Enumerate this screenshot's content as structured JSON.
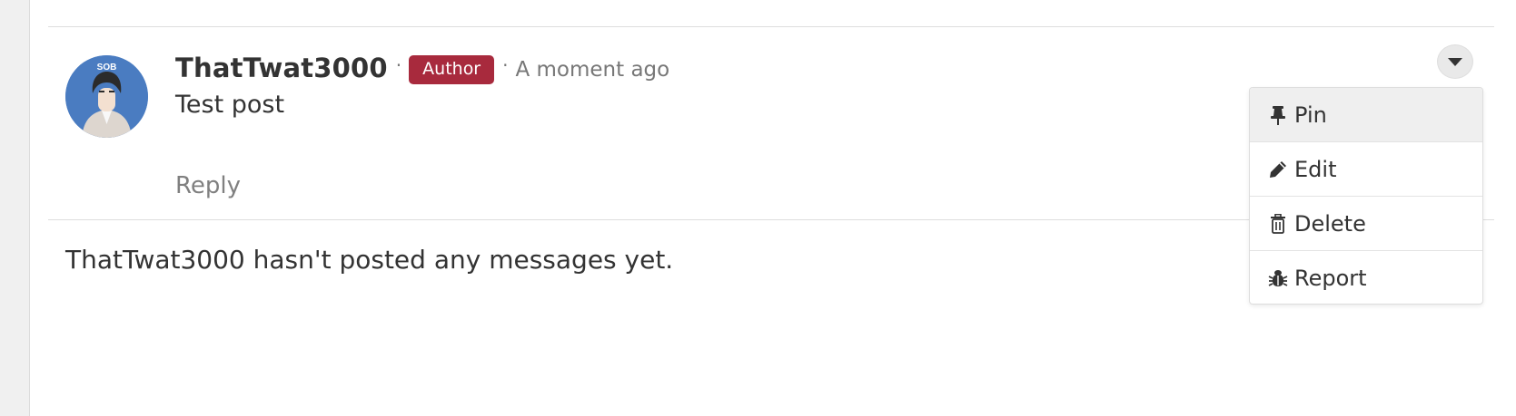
{
  "post": {
    "username": "ThatTwat3000",
    "separator": "·",
    "badge": "Author",
    "timestamp": "A moment ago",
    "body": "Test post",
    "reply_label": "Reply",
    "avatar_text": "SOB"
  },
  "empty_state": {
    "message": "ThatTwat3000 hasn't posted any messages yet."
  },
  "menu": {
    "toggle_icon": "caret-down-icon",
    "items": [
      {
        "label": "Pin",
        "icon": "pin-icon",
        "active": true
      },
      {
        "label": "Edit",
        "icon": "pencil-icon",
        "active": false
      },
      {
        "label": "Delete",
        "icon": "trash-icon",
        "active": false
      },
      {
        "label": "Report",
        "icon": "bug-icon",
        "active": false
      }
    ]
  },
  "colors": {
    "badge": "#a82a3d",
    "avatar_bg": "#4a7cc1",
    "muted_text": "#777777",
    "active_menu_bg": "#efefef"
  }
}
